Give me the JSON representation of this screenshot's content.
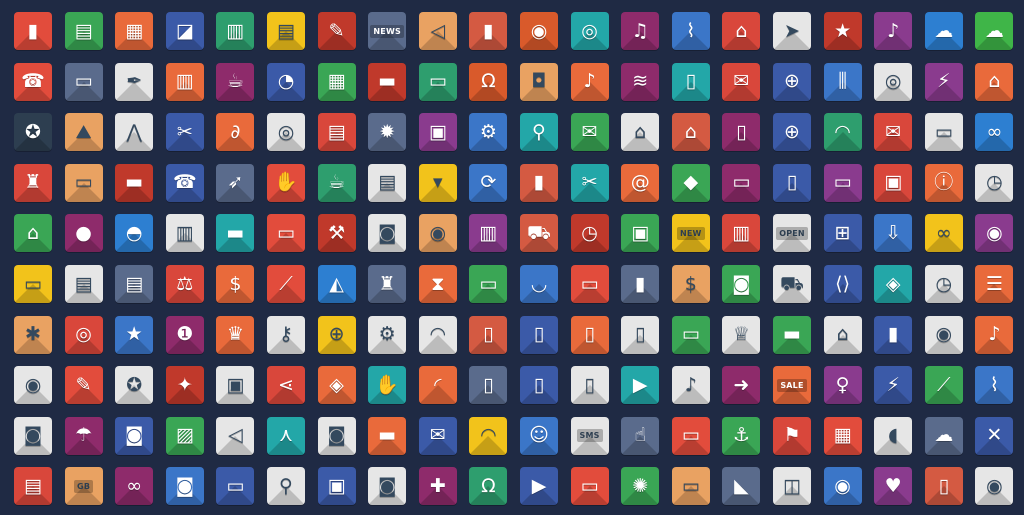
{
  "palette": [
    "#e24c3c",
    "#3aa655",
    "#e96a3b",
    "#3b5aa8",
    "#2e9e6e",
    "#f2c31b",
    "#c0392b",
    "#5a6b8c",
    "#e9a262",
    "#d45a42",
    "#d95a2b",
    "#23a7a8",
    "#8e2b6b",
    "#3b76c8",
    "#d9473b",
    "#e6e6e6",
    "#8a3b8e",
    "#2d7fd1",
    "#3fb548",
    "#f1c40f",
    "#f39c12",
    "#27ae60",
    "#16a085",
    "#9b59b6",
    "#1abc9c",
    "#e67e22",
    "#34495e",
    "#bdc3c7",
    "#7f8c8d",
    "#2980b9"
  ],
  "tags": {
    "news": "NEWS",
    "open": "OPEN",
    "new": "NEW",
    "sale": "SALE",
    "sms": "SMS",
    "gb": "GB"
  },
  "icons": [
    {
      "n": "binders-icon",
      "g": "▮",
      "c": "#e24c3c"
    },
    {
      "n": "notepad-icon",
      "g": "▤",
      "c": "#3aa655"
    },
    {
      "n": "calendar-icon",
      "g": "▦",
      "c": "#e96a3b"
    },
    {
      "n": "presentation-icon",
      "g": "◪",
      "c": "#3b5aa8"
    },
    {
      "n": "filing-cabinet-icon",
      "g": "▥",
      "c": "#2e9e6e"
    },
    {
      "n": "document-icon",
      "g": "▤",
      "c": "#f2c31b"
    },
    {
      "n": "pushpin-icon",
      "g": "✎",
      "c": "#c0392b"
    },
    {
      "n": "newspaper-icon",
      "t": "news",
      "c": "#5a6b8c"
    },
    {
      "n": "speaker-icon",
      "g": "◁",
      "c": "#e9a262"
    },
    {
      "n": "equalizer-icon",
      "g": "▮",
      "c": "#d45a42"
    },
    {
      "n": "turntable-icon",
      "g": "◉",
      "c": "#d95a2b"
    },
    {
      "n": "loudspeaker-icon",
      "g": "◎",
      "c": "#23a7a8"
    },
    {
      "n": "music-note-icon",
      "g": "♫",
      "c": "#8e2b6b"
    },
    {
      "n": "microphone-icon",
      "g": "⌇",
      "c": "#3b76c8"
    },
    {
      "n": "padlock-icon",
      "g": "⌂",
      "c": "#d9473b"
    },
    {
      "n": "paper-plane-icon",
      "g": "➤",
      "c": "#e6e6e6"
    },
    {
      "n": "bookmark-icon",
      "g": "★",
      "c": "#c0392b"
    },
    {
      "n": "maracas-icon",
      "g": "♪",
      "c": "#8a3b8e"
    },
    {
      "n": "cloud-download-icon",
      "g": "☁",
      "c": "#2d7fd1"
    },
    {
      "n": "cloud-upload-icon",
      "g": "☁",
      "c": "#3fb548"
    },
    {
      "n": "contacts-book-icon",
      "g": "☎",
      "c": "#e24c3c"
    },
    {
      "n": "folders-icon",
      "g": "▭",
      "c": "#5a6b8c"
    },
    {
      "n": "pen-tool-icon",
      "g": "✒",
      "c": "#e6e6e6"
    },
    {
      "n": "shredder-icon",
      "g": "▥",
      "c": "#e96a3b"
    },
    {
      "n": "mug-icon",
      "g": "☕",
      "c": "#8e2b6b"
    },
    {
      "n": "pie-chart-icon",
      "g": "◔",
      "c": "#3b5aa8"
    },
    {
      "n": "calculator-icon",
      "g": "▦",
      "c": "#3aa655"
    },
    {
      "n": "briefcase-icon",
      "g": "▬",
      "c": "#c0392b"
    },
    {
      "n": "id-card-icon",
      "g": "▭",
      "c": "#2e9e6e"
    },
    {
      "n": "headphones-icon",
      "g": "Ω",
      "c": "#d95a2b"
    },
    {
      "n": "cassette-icon",
      "g": "◘",
      "c": "#e9a262"
    },
    {
      "n": "guitar-icon",
      "g": "♪",
      "c": "#e96a3b"
    },
    {
      "n": "sound-wave-icon",
      "g": "≋",
      "c": "#8e2b6b"
    },
    {
      "n": "mp3-player-icon",
      "g": "▯",
      "c": "#23a7a8"
    },
    {
      "n": "chat-bubble-icon",
      "g": "✉",
      "c": "#d9473b"
    },
    {
      "n": "globe-pin-icon",
      "g": "⊕",
      "c": "#3b5aa8"
    },
    {
      "n": "mixer-icon",
      "g": "⫼",
      "c": "#3b76c8"
    },
    {
      "n": "speaker-box-icon",
      "g": "◎",
      "c": "#e6e6e6"
    },
    {
      "n": "lightning-icon",
      "g": "⚡",
      "c": "#8a3b8e"
    },
    {
      "n": "antenna-icon",
      "g": "⌂",
      "c": "#e96a3b"
    },
    {
      "n": "award-badge-icon",
      "g": "✪",
      "c": "#2d3e50"
    },
    {
      "n": "landscape-icon",
      "g": "⛰",
      "c": "#e9a262"
    },
    {
      "n": "compass-icon",
      "g": "⋀",
      "c": "#e6e6e6"
    },
    {
      "n": "utility-knife-icon",
      "g": "✂",
      "c": "#3b5aa8"
    },
    {
      "n": "paperclip-icon",
      "g": "∂",
      "c": "#e96a3b"
    },
    {
      "n": "target-icon",
      "g": "◎",
      "c": "#e6e6e6"
    },
    {
      "n": "certificate-icon",
      "g": "▤",
      "c": "#d9473b"
    },
    {
      "n": "lightbulb-icon",
      "g": "✹",
      "c": "#5a6b8c"
    },
    {
      "n": "puzzle-icon",
      "g": "▣",
      "c": "#8a3b8e"
    },
    {
      "n": "gears-icon",
      "g": "⚙",
      "c": "#3b76c8"
    },
    {
      "n": "magnifier-icon",
      "g": "⚲",
      "c": "#23a7a8"
    },
    {
      "n": "envelope-icon",
      "g": "✉",
      "c": "#3aa655"
    },
    {
      "n": "home-icon",
      "g": "⌂",
      "c": "#e6e6e6"
    },
    {
      "n": "unlock-icon",
      "g": "⌂",
      "c": "#d45a42"
    },
    {
      "n": "phone-login-icon",
      "g": "▯",
      "c": "#8e2b6b"
    },
    {
      "n": "globe-icon",
      "g": "⊕",
      "c": "#3b5aa8"
    },
    {
      "n": "speedometer-icon",
      "g": "◠",
      "c": "#2e9e6e"
    },
    {
      "n": "speech-bubbles-icon",
      "g": "✉",
      "c": "#d9473b"
    },
    {
      "n": "router-icon",
      "g": "▭",
      "c": "#e6e6e6"
    },
    {
      "n": "chain-link-icon",
      "g": "∞",
      "c": "#2d7fd1"
    },
    {
      "n": "stamp-icon",
      "g": "♜",
      "c": "#d9473b"
    },
    {
      "n": "monitor-icon",
      "g": "▭",
      "c": "#e9a262"
    },
    {
      "n": "toolbox-icon",
      "g": "▬",
      "c": "#c0392b"
    },
    {
      "n": "fax-icon",
      "g": "☎",
      "c": "#3b5aa8"
    },
    {
      "n": "rocket-icon",
      "g": "➶",
      "c": "#5a6b8c"
    },
    {
      "n": "thumbs-up-icon",
      "g": "✋",
      "c": "#e24c3c"
    },
    {
      "n": "coffee-cup-icon",
      "g": "☕",
      "c": "#2e9e6e"
    },
    {
      "n": "printer-icon",
      "g": "▤",
      "c": "#e6e6e6"
    },
    {
      "n": "necktie-icon",
      "g": "▾",
      "c": "#f2c31b"
    },
    {
      "n": "refresh-icon",
      "g": "⟳",
      "c": "#3b76c8"
    },
    {
      "n": "bar-chart-icon",
      "g": "▮",
      "c": "#d45a42"
    },
    {
      "n": "scissors-icon",
      "g": "✂",
      "c": "#23a7a8"
    },
    {
      "n": "address-book-icon",
      "g": "@",
      "c": "#e96a3b"
    },
    {
      "n": "shield-icon",
      "g": "◆",
      "c": "#3aa655"
    },
    {
      "n": "laptop-icon",
      "g": "▭",
      "c": "#8e2b6b"
    },
    {
      "n": "tablet-icon",
      "g": "▯",
      "c": "#3b5aa8"
    },
    {
      "n": "folder-icon",
      "g": "▭",
      "c": "#8a3b8e"
    },
    {
      "n": "floppy-disk-icon",
      "g": "▣",
      "c": "#d9473b"
    },
    {
      "n": "info-icon",
      "g": "ⓘ",
      "c": "#e96a3b"
    },
    {
      "n": "stopwatch-icon",
      "g": "◷",
      "c": "#e6e6e6"
    },
    {
      "n": "bank-icon",
      "g": "⌂",
      "c": "#3aa655"
    },
    {
      "n": "piggy-bank-icon",
      "g": "●",
      "c": "#8e2b6b"
    },
    {
      "n": "purse-icon",
      "g": "◓",
      "c": "#2d7fd1"
    },
    {
      "n": "cash-register-icon",
      "g": "▥",
      "c": "#e6e6e6"
    },
    {
      "n": "banknote-icon",
      "g": "▬",
      "c": "#23a7a8"
    },
    {
      "n": "credit-card-pay-icon",
      "g": "▭",
      "c": "#e24c3c"
    },
    {
      "n": "gavel-icon",
      "g": "⚒",
      "c": "#c0392b"
    },
    {
      "n": "safe-icon",
      "g": "◙",
      "c": "#e6e6e6"
    },
    {
      "n": "coins-icon",
      "g": "◉",
      "c": "#e9a262"
    },
    {
      "n": "barcode-icon",
      "g": "▥",
      "c": "#8a3b8e"
    },
    {
      "n": "shopping-cart-icon",
      "g": "⛟",
      "c": "#d45a42"
    },
    {
      "n": "wristwatch-icon",
      "g": "◷",
      "c": "#c0392b"
    },
    {
      "n": "gift-icon",
      "g": "▣",
      "c": "#3aa655"
    },
    {
      "n": "new-badge-icon",
      "t": "new",
      "c": "#f2c31b"
    },
    {
      "n": "piano-icon",
      "g": "▥",
      "c": "#d9473b"
    },
    {
      "n": "open-sign-icon",
      "t": "open",
      "c": "#e6e6e6"
    },
    {
      "n": "sitemap-icon",
      "g": "⊞",
      "c": "#3b5aa8"
    },
    {
      "n": "inbox-download-icon",
      "g": "⇩",
      "c": "#3b76c8"
    },
    {
      "n": "3d-glasses-icon",
      "g": "∞",
      "c": "#f2c31b"
    },
    {
      "n": "webcam-icon",
      "g": "◉",
      "c": "#8a3b8e"
    },
    {
      "n": "atm-icon",
      "g": "▭",
      "c": "#f2c31b"
    },
    {
      "n": "receipt-icon",
      "g": "▤",
      "c": "#e6e6e6"
    },
    {
      "n": "invoice-icon",
      "g": "▤",
      "c": "#5a6b8c"
    },
    {
      "n": "scales-icon",
      "g": "⚖",
      "c": "#d9473b"
    },
    {
      "n": "money-bag-icon",
      "g": "$",
      "c": "#e96a3b"
    },
    {
      "n": "line-chart-icon",
      "g": "⟋",
      "c": "#e24c3c"
    },
    {
      "n": "area-chart-icon",
      "g": "◭",
      "c": "#2d7fd1"
    },
    {
      "n": "chess-icon",
      "g": "♜",
      "c": "#5a6b8c"
    },
    {
      "n": "hourglass-icon",
      "g": "⧗",
      "c": "#e96a3b"
    },
    {
      "n": "monitor-chart-icon",
      "g": "▭",
      "c": "#3aa655"
    },
    {
      "n": "basket-icon",
      "g": "◡",
      "c": "#3b76c8"
    },
    {
      "n": "credit-cards-icon",
      "g": "▭",
      "c": "#e24c3c"
    },
    {
      "n": "bottle-icon",
      "g": "▮",
      "c": "#5a6b8c"
    },
    {
      "n": "cash-stack-icon",
      "g": "$",
      "c": "#e9a262"
    },
    {
      "n": "radio-icon",
      "g": "◙",
      "c": "#3aa655"
    },
    {
      "n": "delivery-truck-icon",
      "g": "⛟",
      "c": "#e6e6e6"
    },
    {
      "n": "code-window-icon",
      "g": "⟨⟩",
      "c": "#3b5aa8"
    },
    {
      "n": "layers-icon",
      "g": "◈",
      "c": "#23a7a8"
    },
    {
      "n": "wall-clock-icon",
      "g": "◷",
      "c": "#e6e6e6"
    },
    {
      "n": "server-icon",
      "g": "☰",
      "c": "#e96a3b"
    },
    {
      "n": "bug-icon",
      "g": "✱",
      "c": "#e9a262"
    },
    {
      "n": "lifebuoy-icon",
      "g": "◎",
      "c": "#d9473b"
    },
    {
      "n": "star-icon",
      "g": "★",
      "c": "#3b76c8"
    },
    {
      "n": "medal-icon",
      "g": "❶",
      "c": "#8e2b6b"
    },
    {
      "n": "crown-icon",
      "g": "♛",
      "c": "#e96a3b"
    },
    {
      "n": "key-icon",
      "g": "⚷",
      "c": "#e6e6e6"
    },
    {
      "n": "crosshair-icon",
      "g": "⊕",
      "c": "#f2c31b"
    },
    {
      "n": "settings-window-icon",
      "g": "⚙",
      "c": "#e6e6e6"
    },
    {
      "n": "gauge-icon",
      "g": "◠",
      "c": "#e6e6e6"
    },
    {
      "n": "mobile-phone-icon",
      "g": "▯",
      "c": "#d45a42"
    },
    {
      "n": "feature-phone-icon",
      "g": "▯",
      "c": "#3b5aa8"
    },
    {
      "n": "cell-phone-icon",
      "g": "▯",
      "c": "#e96a3b"
    },
    {
      "n": "flip-phone-icon",
      "g": "▯",
      "c": "#e6e6e6"
    },
    {
      "n": "pager-icon",
      "g": "▭",
      "c": "#3aa655"
    },
    {
      "n": "trophy-icon",
      "g": "♕",
      "c": "#e6e6e6"
    },
    {
      "n": "wallet-icon",
      "g": "▬",
      "c": "#3aa655"
    },
    {
      "n": "storefront-icon",
      "g": "⌂",
      "c": "#e6e6e6"
    },
    {
      "n": "usb-drive-icon",
      "g": "▮",
      "c": "#3b5aa8"
    },
    {
      "n": "compact-disc-icon",
      "g": "◉",
      "c": "#e6e6e6"
    },
    {
      "n": "eighth-note-icon",
      "g": "♪",
      "c": "#e96a3b"
    },
    {
      "n": "eye-icon",
      "g": "◉",
      "c": "#e6e6e6"
    },
    {
      "n": "tools-window-icon",
      "g": "✎",
      "c": "#e24c3c"
    },
    {
      "n": "award-window-icon",
      "g": "✪",
      "c": "#e6e6e6"
    },
    {
      "n": "magic-wand-icon",
      "g": "✦",
      "c": "#c0392b"
    },
    {
      "n": "cpu-chip-icon",
      "g": "▣",
      "c": "#e6e6e6"
    },
    {
      "n": "share-icon",
      "g": "⋖",
      "c": "#d9473b"
    },
    {
      "n": "price-tag-icon",
      "g": "◈",
      "c": "#e96a3b"
    },
    {
      "n": "like-icon",
      "g": "✋",
      "c": "#23a7a8"
    },
    {
      "n": "rss-icon",
      "g": "◜",
      "c": "#e96a3b"
    },
    {
      "n": "smartphone-keypad-icon",
      "g": "▯",
      "c": "#5a6b8c"
    },
    {
      "n": "smartphone-icon",
      "g": "▯",
      "c": "#3b5aa8"
    },
    {
      "n": "touch-phone-icon",
      "g": "▯",
      "c": "#e6e6e6"
    },
    {
      "n": "video-player-icon",
      "g": "▶",
      "c": "#23a7a8"
    },
    {
      "n": "music-phone-icon",
      "g": "♪",
      "c": "#e6e6e6"
    },
    {
      "n": "phone-arrow-icon",
      "g": "➜",
      "c": "#8e2b6b"
    },
    {
      "n": "sale-badge-icon",
      "t": "sale",
      "c": "#e96a3b"
    },
    {
      "n": "dress-icon",
      "g": "♀",
      "c": "#8a3b8e"
    },
    {
      "n": "laptop-power-icon",
      "g": "⚡",
      "c": "#3b5aa8"
    },
    {
      "n": "monitor-graph-icon",
      "g": "⟋",
      "c": "#3aa655"
    },
    {
      "n": "podcast-mic-icon",
      "g": "⌇",
      "c": "#3b76c8"
    },
    {
      "n": "camera-icon",
      "g": "◙",
      "c": "#e6e6e6"
    },
    {
      "n": "umbrella-icon",
      "g": "☂",
      "c": "#8e2b6b"
    },
    {
      "n": "photo-camera-icon",
      "g": "◙",
      "c": "#3b5aa8"
    },
    {
      "n": "photos-icon",
      "g": "▨",
      "c": "#3aa655"
    },
    {
      "n": "megaphone-icon",
      "g": "◁",
      "c": "#e6e6e6"
    },
    {
      "n": "tripod-camera-icon",
      "g": "⋏",
      "c": "#23a7a8"
    },
    {
      "n": "compact-camera-icon",
      "g": "◙",
      "c": "#e6e6e6"
    },
    {
      "n": "suitcase-icon",
      "g": "▬",
      "c": "#e96a3b"
    },
    {
      "n": "mobile-message-icon",
      "g": "✉",
      "c": "#3b5aa8"
    },
    {
      "n": "mobile-wifi-icon",
      "g": "◠",
      "c": "#f2c31b"
    },
    {
      "n": "mobile-user-icon",
      "g": "☺",
      "c": "#3b76c8"
    },
    {
      "n": "sms-phone-icon",
      "t": "sms",
      "c": "#e6e6e6"
    },
    {
      "n": "phone-touch-icon",
      "g": "☝",
      "c": "#5a6b8c"
    },
    {
      "n": "computer-screen-icon",
      "g": "▭",
      "c": "#e24c3c"
    },
    {
      "n": "anchor-icon",
      "g": "⚓",
      "c": "#3aa655"
    },
    {
      "n": "flag-icon",
      "g": "⚑",
      "c": "#d9473b"
    },
    {
      "n": "keyboard-icon",
      "g": "▦",
      "c": "#e24c3c"
    },
    {
      "n": "computer-mouse-icon",
      "g": "◖",
      "c": "#e6e6e6"
    },
    {
      "n": "cloud-settings-icon",
      "g": "☁",
      "c": "#5a6b8c"
    },
    {
      "n": "wrench-screwdriver-icon",
      "g": "✕",
      "c": "#3b5aa8"
    },
    {
      "n": "printer-photo-icon",
      "g": "▤",
      "c": "#d9473b"
    },
    {
      "n": "memory-card-icon",
      "t": "gb",
      "c": "#e9a262"
    },
    {
      "n": "link-icon",
      "g": "∞",
      "c": "#8e2b6b"
    },
    {
      "n": "camera-bag-icon",
      "g": "◙",
      "c": "#3b76c8"
    },
    {
      "n": "film-roll-icon",
      "g": "▭",
      "c": "#3b5aa8"
    },
    {
      "n": "image-search-icon",
      "g": "⚲",
      "c": "#e6e6e6"
    },
    {
      "n": "polaroid-icon",
      "g": "▣",
      "c": "#3b5aa8"
    },
    {
      "n": "video-camera-icon",
      "g": "◙",
      "c": "#e6e6e6"
    },
    {
      "n": "gamepad-icon",
      "g": "✚",
      "c": "#8e2b6b"
    },
    {
      "n": "headset-icon",
      "g": "Ω",
      "c": "#2e9e6e"
    },
    {
      "n": "film-strip-icon",
      "g": "▶",
      "c": "#3b5aa8"
    },
    {
      "n": "television-icon",
      "g": "▭",
      "c": "#e24c3c"
    },
    {
      "n": "film-reel-icon",
      "g": "✺",
      "c": "#3aa655"
    },
    {
      "n": "desktop-icon",
      "g": "▭",
      "c": "#e9a262"
    },
    {
      "n": "high-heel-icon",
      "g": "◣",
      "c": "#5a6b8c"
    },
    {
      "n": "shopping-bag-icon",
      "g": "◫",
      "c": "#e6e6e6"
    },
    {
      "n": "location-pin-icon",
      "g": "◉",
      "c": "#3b76c8"
    },
    {
      "n": "heart-icon",
      "g": "♥",
      "c": "#8a3b8e"
    },
    {
      "n": "ipod-icon",
      "g": "▯",
      "c": "#d45a42"
    },
    {
      "n": "vinyl-record-icon",
      "g": "◉",
      "c": "#e6e6e6"
    }
  ]
}
